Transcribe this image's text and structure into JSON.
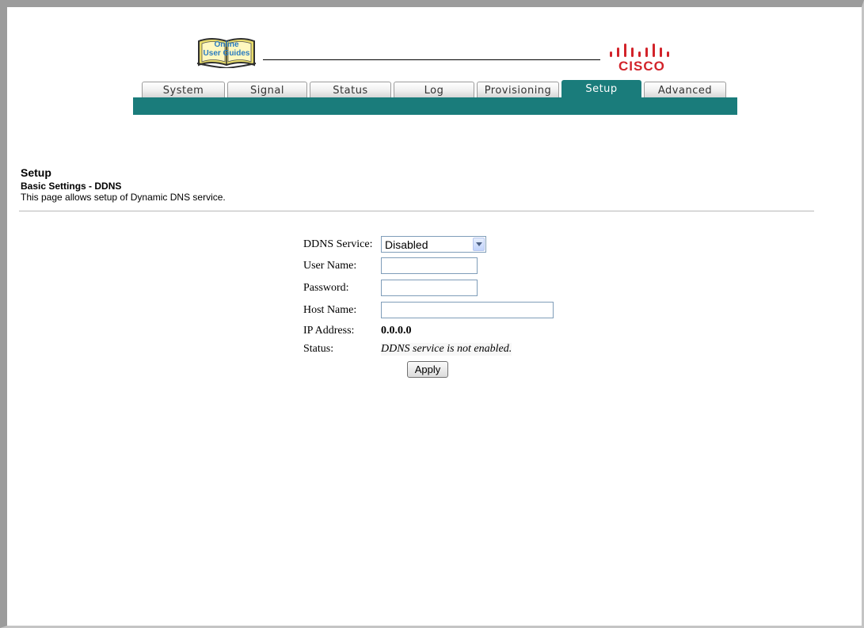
{
  "header": {
    "guide_logo_line1": "Online",
    "guide_logo_line2": "User Guides",
    "brand": "CISCO"
  },
  "tabs": [
    {
      "label": "System",
      "active": false
    },
    {
      "label": "Signal",
      "active": false
    },
    {
      "label": "Status",
      "active": false
    },
    {
      "label": "Log",
      "active": false
    },
    {
      "label": "Provisioning",
      "active": false
    },
    {
      "label": "Setup",
      "active": true
    },
    {
      "label": "Advanced",
      "active": false
    }
  ],
  "page": {
    "title": "Setup",
    "subtitle": "Basic Settings - DDNS",
    "description": "This page allows setup of Dynamic DNS service."
  },
  "form": {
    "ddns_service_label": "DDNS Service:",
    "ddns_service_value": "Disabled",
    "user_name_label": "User Name:",
    "user_name_value": "",
    "password_label": "Password:",
    "password_value": "",
    "host_name_label": "Host Name:",
    "host_name_value": "",
    "ip_address_label": "IP Address:",
    "ip_address_value": "0.0.0.0",
    "status_label": "Status:",
    "status_value": "DDNS service is not enabled.",
    "apply_label": "Apply"
  },
  "colors": {
    "tab_bar": "#1a7c7b",
    "brand_red": "#d2232a"
  }
}
